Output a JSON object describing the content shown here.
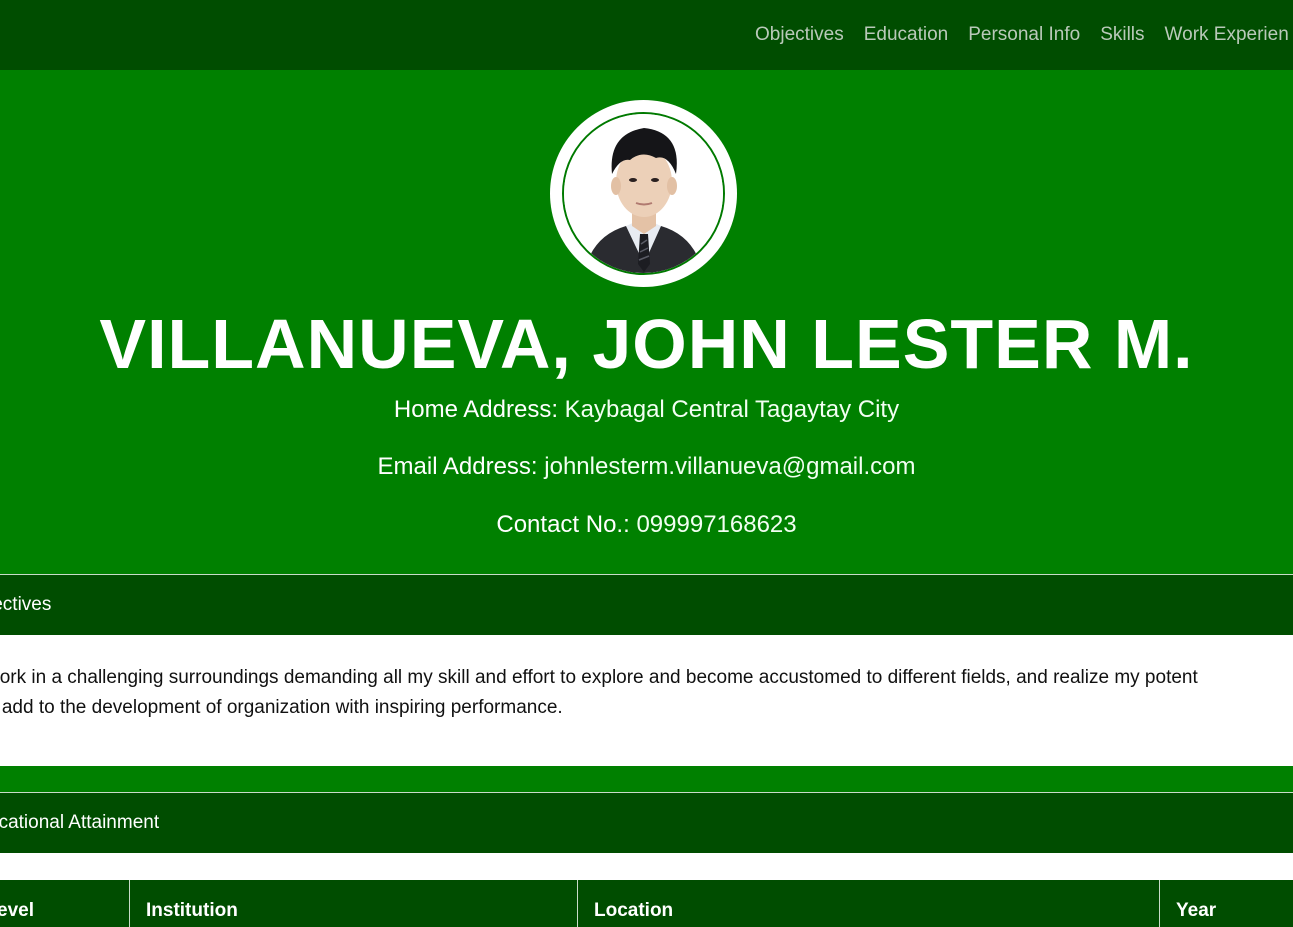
{
  "nav": {
    "items": [
      {
        "label": "Objectives"
      },
      {
        "label": "Education"
      },
      {
        "label": "Personal Info"
      },
      {
        "label": "Skills"
      },
      {
        "label": "Work Experien"
      }
    ]
  },
  "profile": {
    "name": "VILLANUEVA, JOHN LESTER M.",
    "home_label": "Home Address:",
    "home_value": "Kaybagal Central Tagaytay City",
    "email_label": "Email Address:",
    "email_value": "johnlesterm.villanueva@gmail.com",
    "contact_label": "Contact No.:",
    "contact_value": "099997168623"
  },
  "objectives": {
    "header": "jectives",
    "line1": " work in a challenging surroundings demanding all my skill and effort to explore and become accustomed to different fields, and realize my potent",
    "line2": "d add to the development of organization with inspiring performance."
  },
  "education": {
    "header": "ucational Attainment",
    "columns": [
      "evel",
      "Institution",
      "Location",
      "Year"
    ]
  },
  "colors": {
    "primary_green": "#008000",
    "dark_green": "#004d00",
    "white": "#ffffff"
  }
}
